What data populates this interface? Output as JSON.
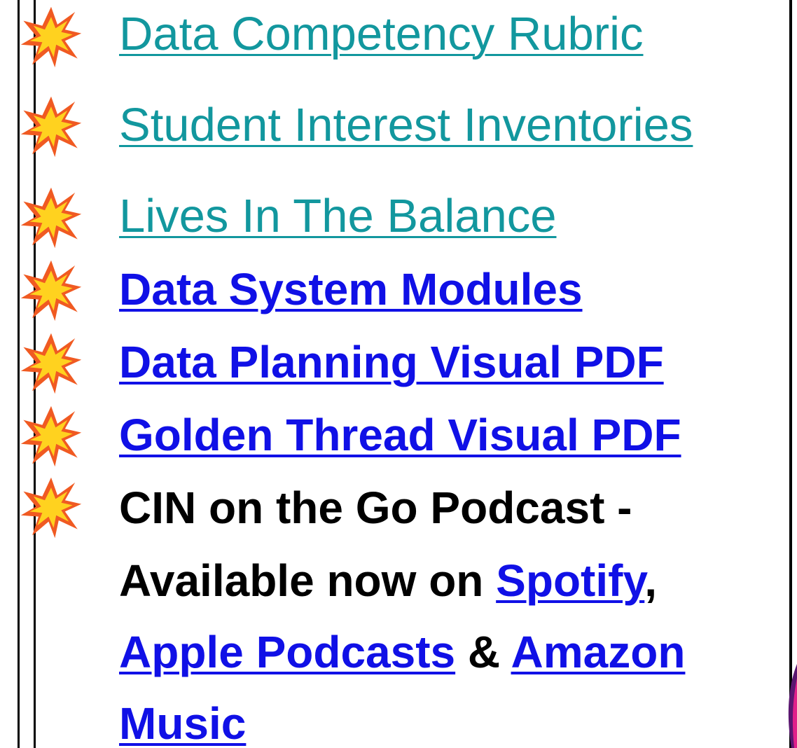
{
  "colors": {
    "teal_link": "#12979e",
    "blue_link": "#1010e6",
    "text": "#000000",
    "frame": "#000000"
  },
  "icon": "collision-burst-icon",
  "links": {
    "data_competency_rubric": "Data Competency Rubric",
    "student_interest_inventories": "Student Interest Inventories",
    "lives_in_the_balance": "Lives In The Balance",
    "data_system_modules": "Data System Modules",
    "data_planning_visual_pdf": "Data Planning Visual PDF",
    "golden_thread_visual_pdf": "Golden Thread Visual PDF"
  },
  "podcast": {
    "title": "CIN on the Go Podcast -",
    "available_text": "Available now on ",
    "spotify": "Spotify",
    "comma": ",",
    "apple": "Apple Podcasts",
    "ampersand": " & ",
    "amazon_part1": "Amazon",
    "amazon_part2": "Music"
  }
}
